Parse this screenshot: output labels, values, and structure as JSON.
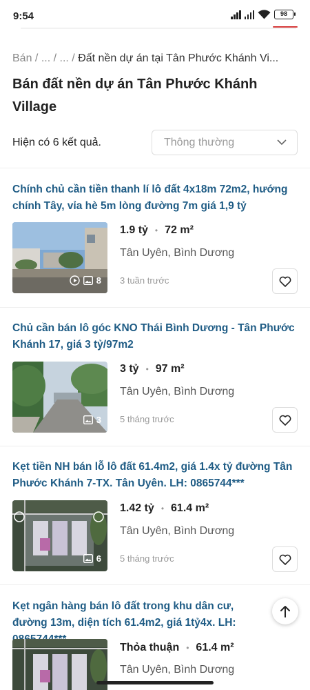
{
  "status": {
    "time": "9:54",
    "battery": "98"
  },
  "breadcrumb": {
    "items": [
      "Bán",
      "...",
      "..."
    ],
    "current": "Đất nền dự án tại Tân Phước Khánh Vi..."
  },
  "page": {
    "title": "Bán đất nền dự án Tân Phước Khánh Village",
    "result_count": "Hiện có 6 kết quả.",
    "sort_selected": "Thông thường"
  },
  "listings": [
    {
      "title": "Chính chủ cần tiền thanh lí lô đất 4x18m 72m2, hướng chính Tây, vỉa hè 5m lòng đường 7m giá 1,9 tỷ",
      "price": "1.9 tỷ",
      "area": "72 m²",
      "location": "Tân Uyên, Bình Dương",
      "time_ago": "3 tuần trước",
      "photo_count": "8",
      "has_video": true
    },
    {
      "title": "Chủ cần bán lô góc KNO Thái Bình Dương - Tân Phước Khánh 17, giá 3 tỷ/97m2",
      "price": "3 tỷ",
      "area": "97 m²",
      "location": "Tân Uyên, Bình Dương",
      "time_ago": "5 tháng trước",
      "photo_count": "3",
      "has_video": false
    },
    {
      "title": "Kẹt tiền NH bán lỗ lô đất 61.4m2, giá 1.4x tỷ đường Tân Phước Khánh 7-TX. Tân Uyên. LH: 0865744***",
      "price": "1.42 tỷ",
      "area": "61.4 m²",
      "location": "Tân Uyên, Bình Dương",
      "time_ago": "5 tháng trước",
      "photo_count": "6",
      "has_video": false
    },
    {
      "title": "Kẹt ngân hàng bán lô đất trong khu dân cư, đường 13m, diện tích 61.4m2, giá 1tỷ4x. LH: 0865744***",
      "price": "Thỏa thuận",
      "area": "61.4 m²",
      "location": "Tân Uyên, Bình Dương"
    }
  ],
  "colors": {
    "title_link": "#1f5c85",
    "battery_underline": "#d63a3a"
  }
}
